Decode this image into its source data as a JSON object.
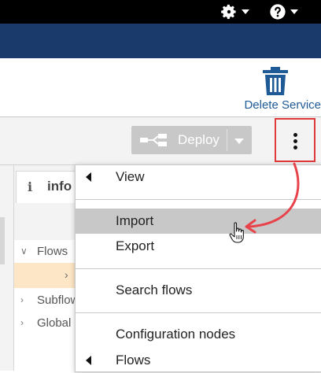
{
  "header": {
    "settings_icon": "gear-icon",
    "help_icon": "question-icon",
    "colors": {
      "topbar": "#000000",
      "header": "#1a3a6b",
      "link": "#1e5a96"
    }
  },
  "service": {
    "delete_label": "Delete Service",
    "delete_icon": "trash-icon"
  },
  "deploy": {
    "label": "Deploy",
    "menu_icon": "kebab-menu-icon",
    "highlight_color": "#e0393b"
  },
  "sidebar": {
    "info_tab": {
      "icon": "i",
      "label": "info"
    },
    "tree": [
      {
        "label": "Flows",
        "expanded": true
      },
      {
        "label": "Subflows",
        "expanded": false
      },
      {
        "label": "Global",
        "expanded": false
      }
    ]
  },
  "menu": {
    "items": [
      {
        "label": "View",
        "submenu": true
      },
      {
        "label": "Import",
        "highlighted": true
      },
      {
        "label": "Export"
      },
      {
        "label": "Search flows"
      },
      {
        "label": "Configuration nodes"
      },
      {
        "label": "Flows",
        "submenu": true
      }
    ],
    "highlight_color": "#c8c8c8"
  }
}
